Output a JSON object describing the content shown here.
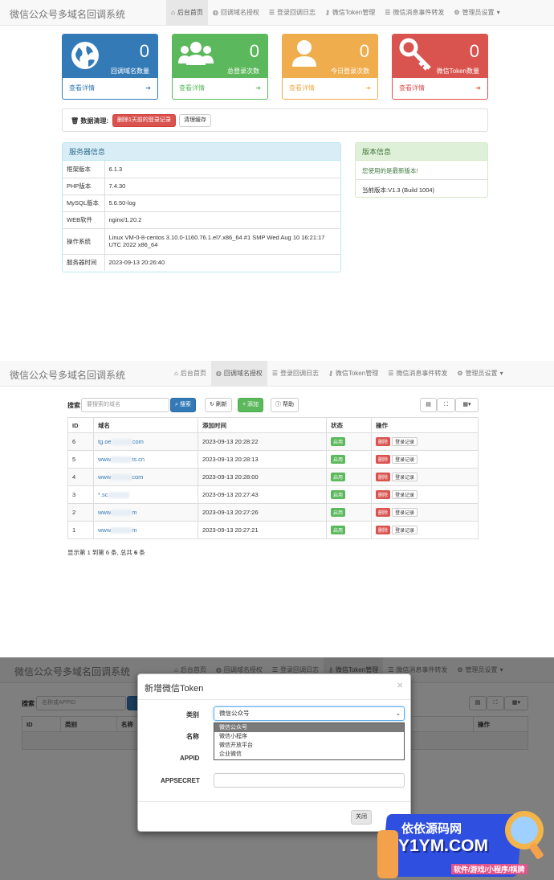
{
  "app_title": "微信公众号多域名回调系统",
  "nav": {
    "home": "后台首页",
    "domain": "回调域名授权",
    "log": "登录回调日志",
    "token": "微信Token管理",
    "event": "微信消息事件转发",
    "admin": "管理员设置"
  },
  "stats": [
    {
      "value": "0",
      "label": "回调域名数量",
      "link": "查看详情",
      "color": "#337ab7",
      "icon": "globe-icon"
    },
    {
      "value": "0",
      "label": "总登录次数",
      "link": "查看详情",
      "color": "#5cb85c",
      "icon": "users-icon"
    },
    {
      "value": "0",
      "label": "今日登录次数",
      "link": "查看详情",
      "color": "#f0ad4e",
      "icon": "user-icon"
    },
    {
      "value": "0",
      "label": "微信Token数量",
      "link": "查看详情",
      "color": "#d9534f",
      "icon": "key-icon"
    }
  ],
  "cleanup": {
    "title": "数据清理:",
    "btn_delete": "删除1天前的登录记录",
    "btn_cache": "清理缓存"
  },
  "server": {
    "title": "服务器信息",
    "rows": [
      {
        "k": "框架版本",
        "v": "6.1.3"
      },
      {
        "k": "PHP版本",
        "v": "7.4.30"
      },
      {
        "k": "MySQL版本",
        "v": "5.6.50-log"
      },
      {
        "k": "WEB软件",
        "v": "nginx/1.20.2"
      },
      {
        "k": "操作系统",
        "v": "Linux VM-0-8-centos 3.10.0-1160.76.1.el7.x86_64 #1 SMP Wed Aug 10 16:21:17 UTC 2022 x86_64"
      },
      {
        "k": "服务器时间",
        "v": "2023-09-13 20:26:40"
      }
    ]
  },
  "version": {
    "title": "版本信息",
    "status": "您使用的是最新版本!",
    "current": "当前版本:V1.3 (Build 1004)"
  },
  "domain_page": {
    "search_label": "搜索",
    "search_placeholder": "要搜索的域名",
    "btn_search": "搜索",
    "btn_refresh": "刷新",
    "btn_add": "添加",
    "btn_help": "帮助",
    "columns": [
      "ID",
      "域名",
      "添加时间",
      "状态",
      "操作"
    ],
    "rows": [
      {
        "id": "6",
        "domain_a": "tg.oe",
        "domain_b": "com",
        "time": "2023-09-13 20:28:22"
      },
      {
        "id": "5",
        "domain_a": "www",
        "domain_b": "ts.cn",
        "time": "2023-09-13 20:28:13"
      },
      {
        "id": "4",
        "domain_a": "www",
        "domain_b": "com",
        "time": "2023-09-13 20:28:00"
      },
      {
        "id": "3",
        "domain_a": "*.sc",
        "domain_b": "",
        "time": "2023-09-13 20:27:43"
      },
      {
        "id": "2",
        "domain_a": "www",
        "domain_b": "m",
        "time": "2023-09-13 20:27:26"
      },
      {
        "id": "1",
        "domain_a": "www",
        "domain_b": "m",
        "time": "2023-09-13 20:27:21"
      }
    ],
    "status": "启用",
    "op_delete": "删除",
    "op_log": "登录记录",
    "summary_a": "显示第 1 到第 6 条, 总共 ",
    "summary_b": "6",
    "summary_c": " 条"
  },
  "token_page": {
    "search_label": "搜索",
    "search_placeholder": "名称或APPID",
    "columns": [
      "ID",
      "类别",
      "名称",
      "操作"
    ]
  },
  "modal": {
    "title": "新增微信Token",
    "close": "×",
    "type_label": "类别",
    "name_label": "名称",
    "appid_label": "APPID",
    "secret_label": "APPSECRET",
    "selected": "微信公众号",
    "options": [
      "微信公众号",
      "微信小程序",
      "微信开放平台",
      "企业微信"
    ],
    "btn_close": "关闭"
  },
  "watermark": {
    "line1": "依依源码网",
    "line2": "Y1YM.COM",
    "line3": "软件/游戏/小程序/棋牌"
  }
}
